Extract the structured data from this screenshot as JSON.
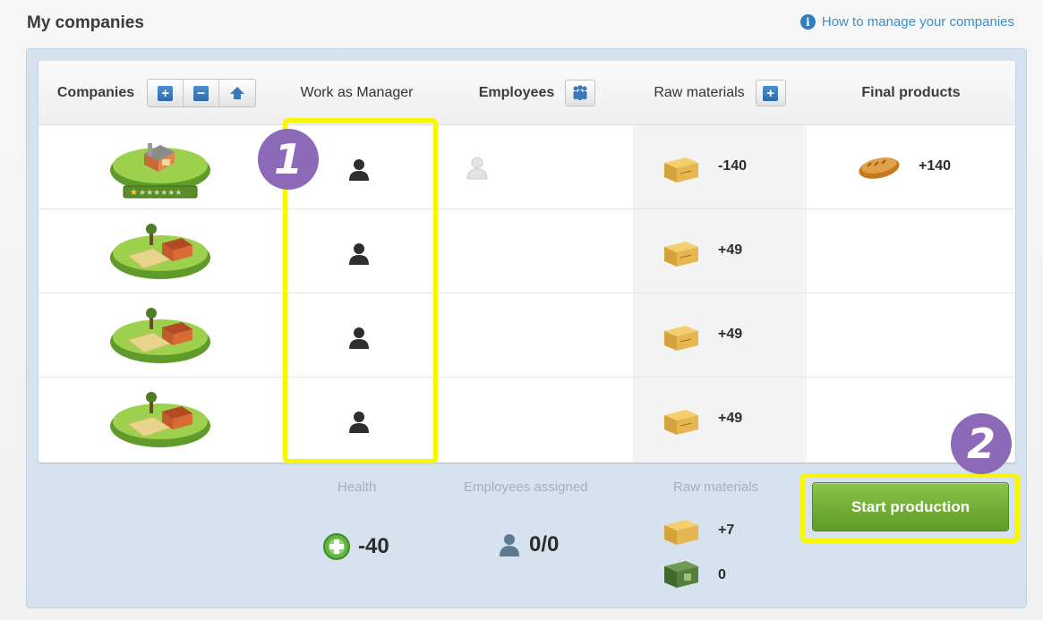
{
  "header": {
    "title": "My companies",
    "help_link": "How to manage your companies",
    "info_icon": "i"
  },
  "table": {
    "columns": {
      "companies": "Companies",
      "work_as_manager": "Work as Manager",
      "employees": "Employees",
      "raw_materials": "Raw materials",
      "final_products": "Final products"
    },
    "company_buttons": [
      "plus-icon",
      "minus-icon",
      "upgrade-icon"
    ],
    "rows": [
      {
        "company": "factory",
        "raw": "-140",
        "final": "+140",
        "has_employee": true
      },
      {
        "company": "farm",
        "raw": "+49",
        "final": "",
        "has_employee": false
      },
      {
        "company": "farm",
        "raw": "+49",
        "final": "",
        "has_employee": false
      },
      {
        "company": "farm",
        "raw": "+49",
        "final": "",
        "has_employee": false
      }
    ]
  },
  "footer": {
    "health_label": "Health",
    "health_value": "-40",
    "employees_label": "Employees assigned",
    "employees_value": "0/0",
    "raw_label": "Raw materials",
    "raw_value": "+7",
    "money_value": "0"
  },
  "actions": {
    "start_production": "Start production"
  },
  "annotations": {
    "badge_1": "1",
    "badge_2": "2"
  },
  "colors": {
    "highlight": "#f7f700",
    "badge": "#8d6ab8",
    "start_button": "#6fab33",
    "panel": "#d6e3ee",
    "link": "#3e8ec9"
  }
}
